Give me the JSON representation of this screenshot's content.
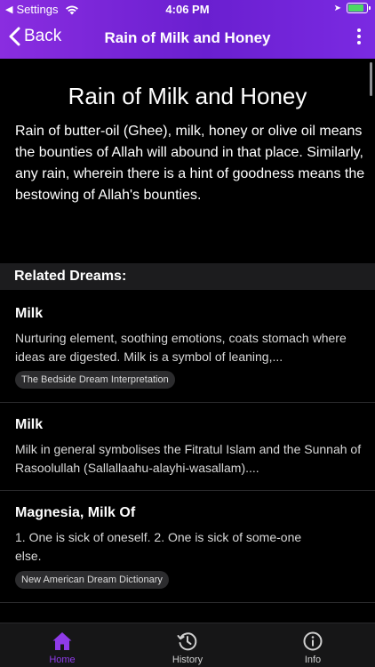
{
  "status_bar": {
    "back_app": "Settings",
    "time": "4:06 PM"
  },
  "nav": {
    "back_label": "Back",
    "title": "Rain of Milk and Honey"
  },
  "article": {
    "heading": "Rain of Milk and Honey",
    "body": "Rain of butter-oil (Ghee), milk, honey or olive oil means the bounties of Allah will abound in that place. Similarly, any rain, wherein there is a hint of goodness means the bestowing of Allah's bounties."
  },
  "related": {
    "header": "Related Dreams:",
    "items": [
      {
        "name": "Milk",
        "text": "Nurturing element, soothing emotions, coats stomach where ideas are digested. Milk is a symbol of leaning,...",
        "tag": "The Bedside Dream Interpretation"
      },
      {
        "name": "Milk",
        "text": "Milk in general symbolises the Fitratul Islam and the Sunnah of Rasoolullah (Sallallaahu-alayhi-wasallam)....",
        "tag": ""
      },
      {
        "name": "Magnesia, Milk Of",
        "text": "1. One is sick of oneself. 2. One is sick of some-one else.",
        "tag": "New American Dream Dictionary"
      }
    ]
  },
  "tabs": [
    {
      "label": "Home",
      "icon": "home-icon",
      "active": true
    },
    {
      "label": "History",
      "icon": "history-icon",
      "active": false
    },
    {
      "label": "Info",
      "icon": "info-icon",
      "active": false
    }
  ],
  "colors": {
    "accent": "#8f3be8",
    "nav_gradient_start": "#8a2de0",
    "nav_gradient_end": "#6a1fd0",
    "background": "#000000"
  }
}
